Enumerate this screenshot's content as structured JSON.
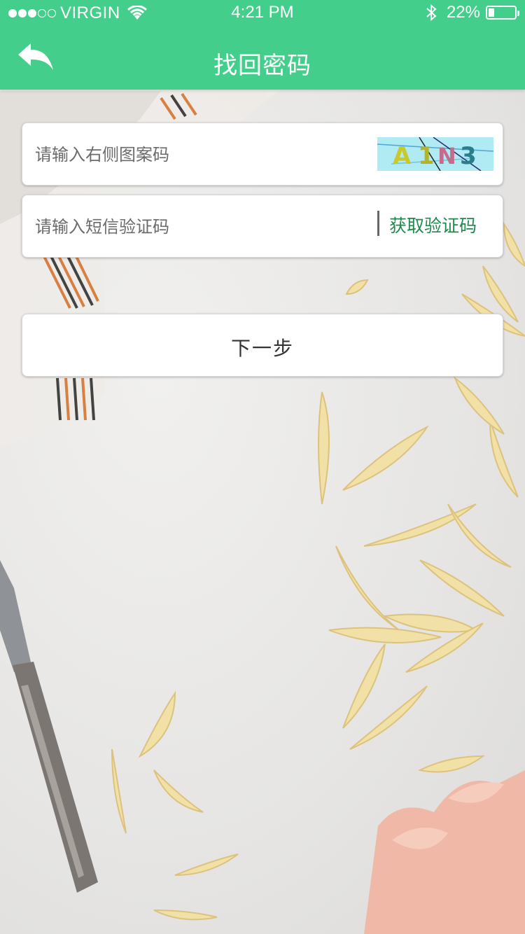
{
  "status_bar": {
    "carrier": "VIRGIN",
    "time": "4:21 PM",
    "battery": "22%",
    "battery_level": 0.22
  },
  "header": {
    "title": "找回密码",
    "back_icon": "back-arrow-icon",
    "background_color": "#43cf8b"
  },
  "form": {
    "captcha_placeholder": "请输入右侧图案码",
    "captcha_image_text": "A1N3",
    "sms_placeholder": "请输入短信验证码",
    "get_code_label": "获取验证码",
    "next_label": "下一步"
  },
  "colors": {
    "accent": "#43cf8b",
    "link": "#1f8a4c"
  }
}
